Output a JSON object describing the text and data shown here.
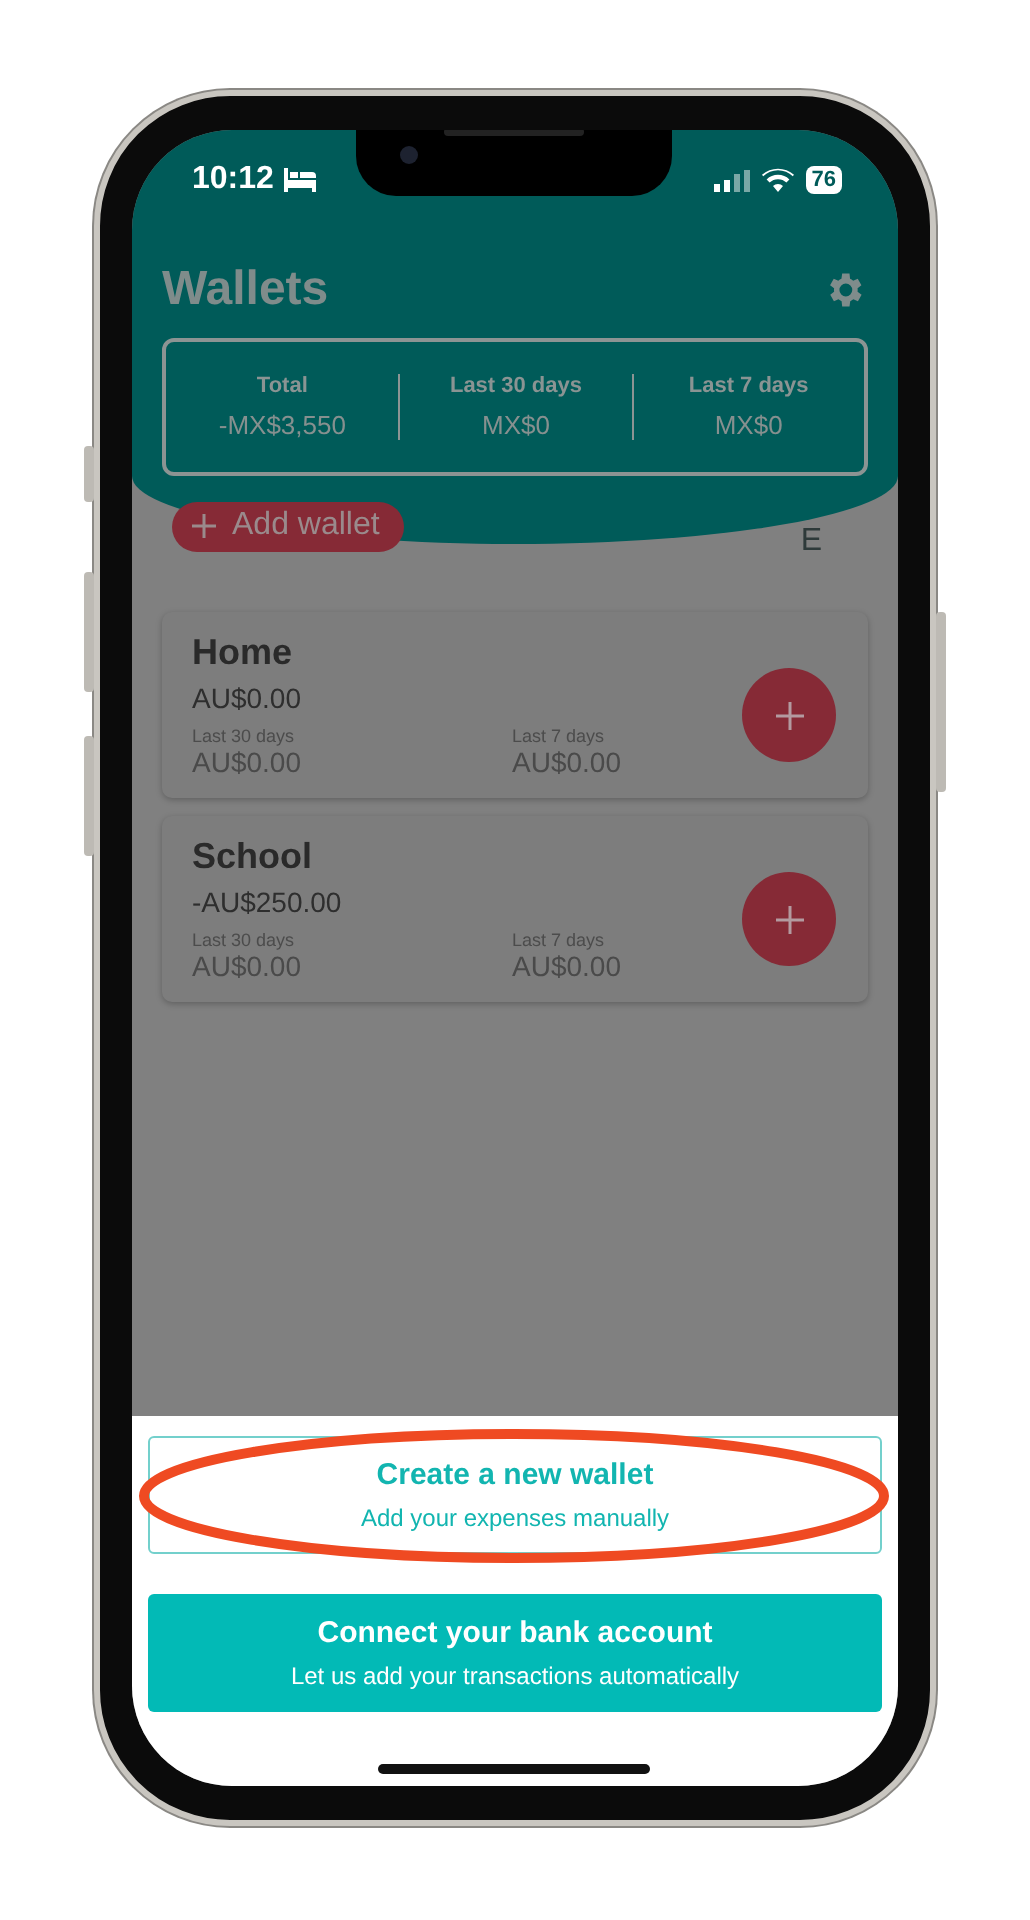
{
  "status_bar": {
    "time": "10:12",
    "battery": "76"
  },
  "header": {
    "title": "Wallets",
    "stats": [
      {
        "label": "Total",
        "value": "-MX$3,550"
      },
      {
        "label": "Last 30 days",
        "value": "MX$0"
      },
      {
        "label": "Last 7 days",
        "value": "MX$0"
      }
    ]
  },
  "add_wallet": {
    "label": "Add wallet"
  },
  "edit_link": "E",
  "wallets": [
    {
      "name": "Home",
      "balance": "AU$0.00",
      "periods": [
        {
          "label": "Last 30 days",
          "value": "AU$0.00"
        },
        {
          "label": "Last 7 days",
          "value": "AU$0.00"
        }
      ]
    },
    {
      "name": "School",
      "balance": "-AU$250.00",
      "periods": [
        {
          "label": "Last 30 days",
          "value": "AU$0.00"
        },
        {
          "label": "Last 7 days",
          "value": "AU$0.00"
        }
      ]
    }
  ],
  "sheet": {
    "options": [
      {
        "kind": "outline",
        "title": "Create a new wallet",
        "subtitle": "Add your expenses manually",
        "highlighted": true
      },
      {
        "kind": "filled",
        "title": "Connect your bank account",
        "subtitle": "Let us add your transactions automatically",
        "highlighted": false
      }
    ]
  }
}
